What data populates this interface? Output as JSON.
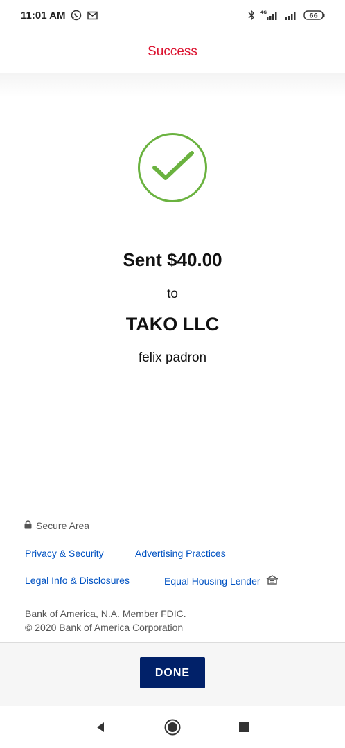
{
  "status_bar": {
    "time": "11:01 AM",
    "battery": "66"
  },
  "header": {
    "title": "Success"
  },
  "confirmation": {
    "sent_text": "Sent $40.00",
    "to_text": "to",
    "recipient": "TAKO LLC",
    "contact": "felix padron"
  },
  "footer": {
    "secure_area": "Secure Area",
    "links": {
      "privacy": "Privacy & Security",
      "advertising": "Advertising Practices",
      "legal": "Legal Info & Disclosures",
      "housing": "Equal Housing Lender"
    },
    "legal_line1": "Bank of America, N.A. Member FDIC.",
    "legal_line2": "© 2020 Bank of America Corporation"
  },
  "actions": {
    "done_label": "DONE"
  },
  "colors": {
    "header_title": "#dc1431",
    "check_green": "#6ab23f",
    "link_blue": "#0052c2",
    "done_bg": "#012169"
  },
  "icons": {
    "status_left": [
      "whatsapp-icon",
      "gmail-icon"
    ],
    "status_right": [
      "bluetooth-icon",
      "signal-4g-icon",
      "signal-icon",
      "battery-icon"
    ],
    "nav": [
      "back-icon",
      "home-icon",
      "recents-icon"
    ]
  }
}
